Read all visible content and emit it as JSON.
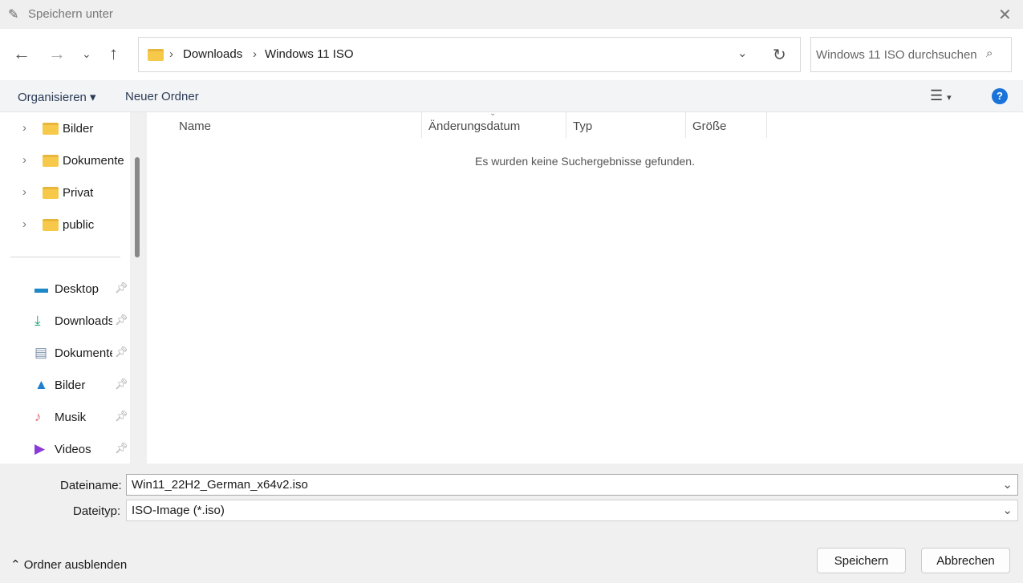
{
  "window": {
    "title": "Speichern unter"
  },
  "breadcrumb": [
    "Downloads",
    "Windows 11 ISO"
  ],
  "search": {
    "placeholder": "Windows 11 ISO durchsuchen"
  },
  "toolbar": {
    "organize": "Organisieren",
    "new_folder": "Neuer Ordner"
  },
  "tree": [
    {
      "label": "Bilder"
    },
    {
      "label": "Dokumente"
    },
    {
      "label": "Privat"
    },
    {
      "label": "public"
    }
  ],
  "quick_access": [
    {
      "label": "Desktop",
      "icon": "desktop-icon",
      "color": "#1e88c8"
    },
    {
      "label": "Downloads",
      "icon": "download-icon",
      "color": "#1aa37a"
    },
    {
      "label": "Dokumente",
      "icon": "document-icon",
      "color": "#7a8fa8"
    },
    {
      "label": "Bilder",
      "icon": "pictures-icon",
      "color": "#1e7fd0"
    },
    {
      "label": "Musik",
      "icon": "music-icon",
      "color": "#e0707a"
    },
    {
      "label": "Videos",
      "icon": "videos-icon",
      "color": "#8a3ad6"
    }
  ],
  "columns": [
    "Name",
    "Änderungsdatum",
    "Typ",
    "Größe"
  ],
  "empty_message": "Es wurden keine Suchergebnisse gefunden.",
  "form": {
    "filename_label": "Dateiname:",
    "filename": "Win11_22H2_German_x64v2.iso",
    "filetype_label": "Dateityp:",
    "filetype": "ISO-Image (*.iso)"
  },
  "footer": {
    "hide_folders": "Ordner ausblenden",
    "save": "Speichern",
    "cancel": "Abbrechen"
  }
}
